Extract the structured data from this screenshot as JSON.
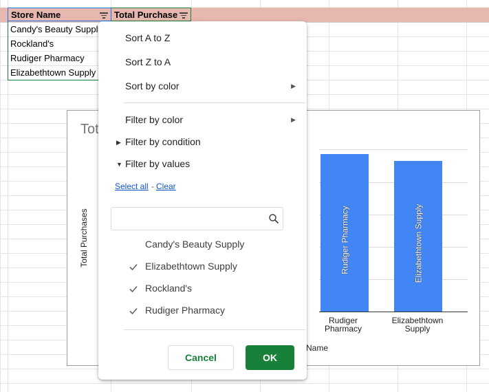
{
  "sheet": {
    "headers": {
      "store_name": "Store Name",
      "total_purchase": "Total Purchase"
    },
    "rows": [
      "Candy's Beauty Supply",
      "Rockland's",
      "Rudiger Pharmacy",
      "Elizabethtown Supply"
    ],
    "header_color": "#e6b8af"
  },
  "chart": {
    "title_visible": "Tot",
    "ylabel": "Total Purchases",
    "xlabel": "Name",
    "bar_color": "#4285f4"
  },
  "chart_data": {
    "type": "bar",
    "categories": [
      "Rudiger Pharmacy",
      "Elizabethtown Supply"
    ],
    "values": [
      229,
      219
    ],
    "xlabel": "Name",
    "ylabel": "Total Purchases"
  },
  "filter_menu": {
    "sort_az": "Sort A to Z",
    "sort_za": "Sort Z to A",
    "sort_by_color": "Sort by color",
    "filter_by_color": "Filter by color",
    "filter_by_condition": "Filter by condition",
    "filter_by_values": "Filter by values",
    "select_all": "Select all",
    "separator": "-",
    "clear": "Clear",
    "search_value": "",
    "values": [
      {
        "label": "Candy's Beauty Supply",
        "checked": false
      },
      {
        "label": "Elizabethtown Supply",
        "checked": true
      },
      {
        "label": "Rockland's",
        "checked": true
      },
      {
        "label": "Rudiger Pharmacy",
        "checked": true
      }
    ],
    "cancel": "Cancel",
    "ok": "OK",
    "accent": "#188038"
  }
}
